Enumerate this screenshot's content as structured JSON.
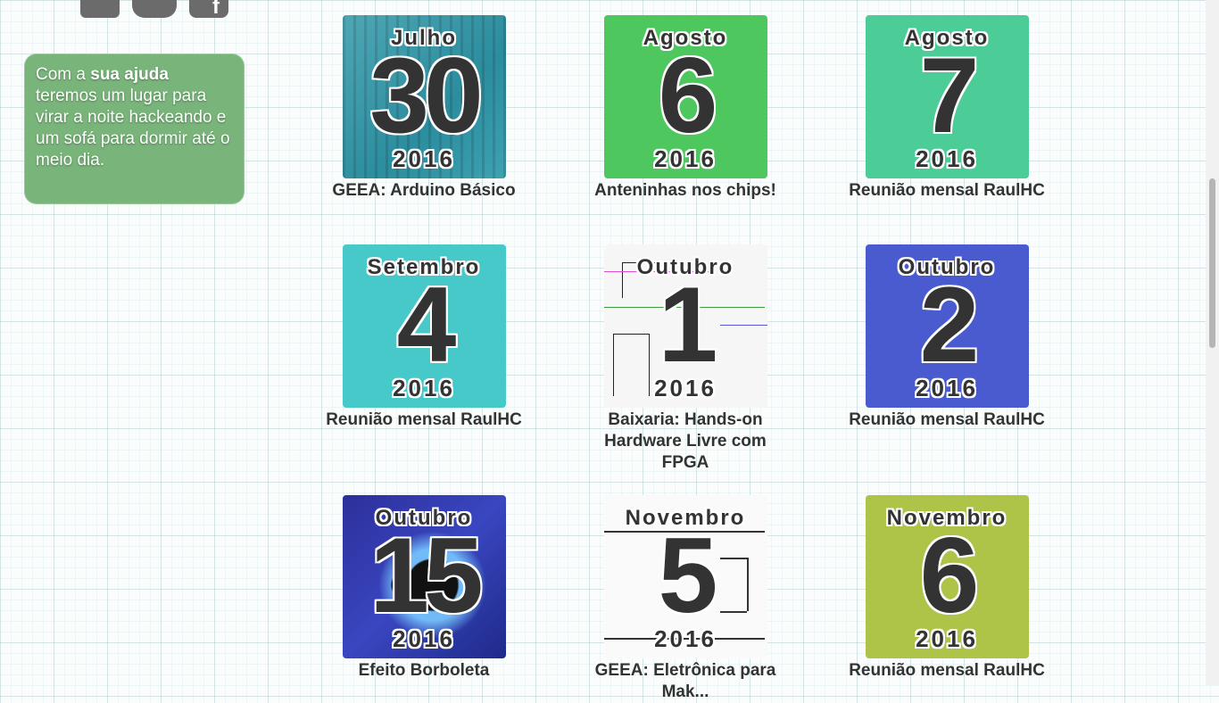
{
  "social": {
    "icons": [
      "mail-icon",
      "chat-icon",
      "facebook-icon"
    ]
  },
  "help_box": {
    "prefix": "Com a ",
    "bold": "sua ajuda",
    "suffix": " teremos um lugar para virar a noite hackeando e um sofá para dormir até o meio dia."
  },
  "events": [
    {
      "month": "Julho",
      "day": "30",
      "year": "2016",
      "title": "GEEA: Arduino Básico",
      "style": "image",
      "image": "arduino-board"
    },
    {
      "month": "Agosto",
      "day": "6",
      "year": "2016",
      "title": "Anteninhas nos chips!",
      "style": "color",
      "color": "#4dc75e"
    },
    {
      "month": "Agosto",
      "day": "7",
      "year": "2016",
      "title": "Reunião mensal RaulHC",
      "style": "color",
      "color": "#4ccc97"
    },
    {
      "month": "Setembro",
      "day": "4",
      "year": "2016",
      "title": "Reunião mensal RaulHC",
      "style": "color",
      "color": "#47c9c9"
    },
    {
      "month": "Outubro",
      "day": "1",
      "year": "2016",
      "title": "Baixaria: Hands-on Hardware Livre com FPGA",
      "style": "image",
      "image": "schematic"
    },
    {
      "month": "Outubro",
      "day": "2",
      "year": "2016",
      "title": "Reunião mensal RaulHC",
      "style": "color",
      "color": "#4a5bcf"
    },
    {
      "month": "Outubro",
      "day": "15",
      "year": "2016",
      "title": "Efeito Borboleta",
      "style": "image",
      "image": "fractal"
    },
    {
      "month": "Novembro",
      "day": "5",
      "year": "2016",
      "title": "GEEA: Eletrônica para Mak...",
      "style": "image",
      "image": "circuit"
    },
    {
      "month": "Novembro",
      "day": "6",
      "year": "2016",
      "title": "Reunião mensal RaulHC",
      "style": "color",
      "color": "#adc448"
    }
  ]
}
